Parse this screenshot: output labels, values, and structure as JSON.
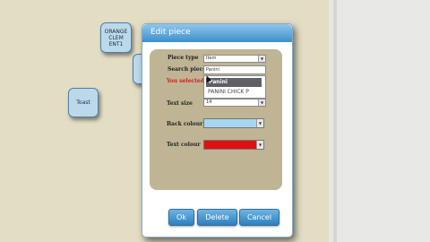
{
  "tiles": [
    {
      "lines": [
        "ORANGE",
        "CLEM",
        "ENT1"
      ]
    },
    {
      "lines": [
        "Toast"
      ]
    }
  ],
  "dialog": {
    "title": "Edit piece",
    "labels": {
      "piece_type": "Piece type",
      "search_piece": "Search piece",
      "you_selected": "You selected",
      "text_size": "Text size",
      "back_colour": "Back colour",
      "text_colour": "Text colour"
    },
    "piece_type_value": "Item",
    "search_value": "Panini",
    "dropdown_options": [
      "Panini",
      "PANINI CHICK P"
    ],
    "text_size_value": "14",
    "back_colour": "#a8d6f0",
    "text_colour": "#e01010",
    "buttons": {
      "ok": "Ok",
      "delete": "Delete",
      "cancel": "Cancel"
    }
  }
}
